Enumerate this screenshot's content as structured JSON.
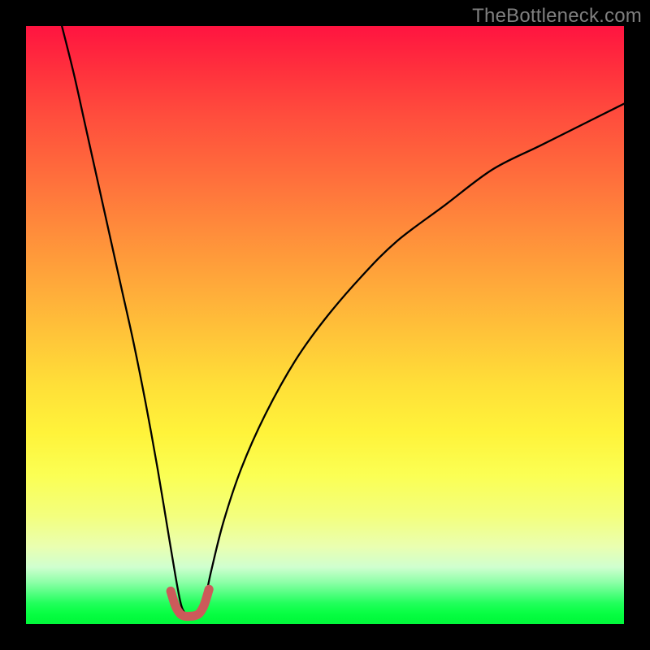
{
  "watermark": "TheBottleneck.com",
  "colors": {
    "frame": "#000000",
    "curve_main": "#000000",
    "curve_bottom": "#cc5a5a",
    "gradient_top": "#ff1440",
    "gradient_bottom": "#02f83b"
  },
  "chart_data": {
    "type": "line",
    "title": "",
    "xlabel": "",
    "ylabel": "",
    "xlim": [
      0,
      100
    ],
    "ylim": [
      0,
      100
    ],
    "grid": false,
    "legend": false,
    "note": "Values estimated from pixel positions; chart has no visible tick labels, so x and y are on a 0–100 normalized scale. y appears to represent bottleneck/mismatch percentage (0 = green/good, 100 = red/bad). The curve descends steeply from top-left, reaches a minimum near x≈26–29 where a short red-highlighted segment sits near y≈0–2, then rises with decreasing slope toward the top-right.",
    "series": [
      {
        "name": "main-curve",
        "color": "#000000",
        "x": [
          6,
          8,
          10,
          12,
          14,
          16,
          18,
          20,
          22,
          23.5,
          25,
          26,
          27,
          28,
          29,
          30,
          31,
          33,
          36,
          40,
          45,
          50,
          56,
          62,
          70,
          78,
          86,
          94,
          100
        ],
        "y": [
          100,
          92,
          83,
          74,
          65,
          56,
          47,
          37,
          26,
          17,
          8,
          3,
          1.5,
          1.3,
          2,
          4.5,
          9,
          17,
          26,
          35,
          44,
          51,
          58,
          64,
          70,
          76,
          80,
          84,
          87
        ]
      },
      {
        "name": "highlight-near-minimum",
        "color": "#cc5a5a",
        "x": [
          24.2,
          25.0,
          25.8,
          26.6,
          27.4,
          28.2,
          29.0,
          29.8,
          30.6
        ],
        "y": [
          5.5,
          3.0,
          1.7,
          1.3,
          1.3,
          1.4,
          1.8,
          3.2,
          5.8
        ]
      }
    ]
  }
}
